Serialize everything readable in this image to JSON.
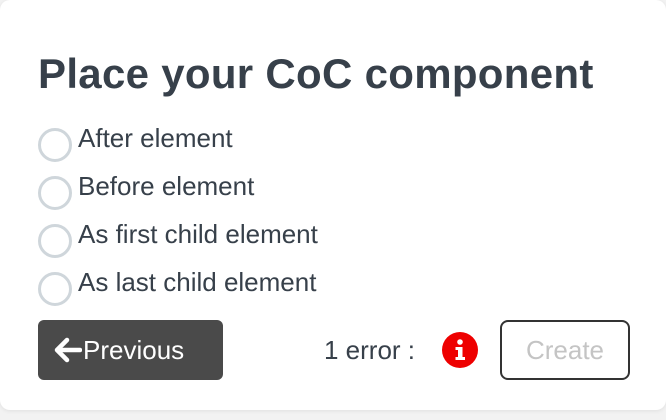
{
  "dialog": {
    "title": "Place your CoC component",
    "options": [
      {
        "label": "After element",
        "selected": false
      },
      {
        "label": "Before element",
        "selected": false
      },
      {
        "label": "As first child element",
        "selected": false
      },
      {
        "label": "As last child element",
        "selected": false
      }
    ]
  },
  "footer": {
    "previous_label": "Previous",
    "previous_icon": "arrow-left-icon",
    "error_text": "1 error :",
    "error_icon": "info-icon",
    "error_color": "#ee0000",
    "create_label": "Create",
    "create_disabled": true
  }
}
